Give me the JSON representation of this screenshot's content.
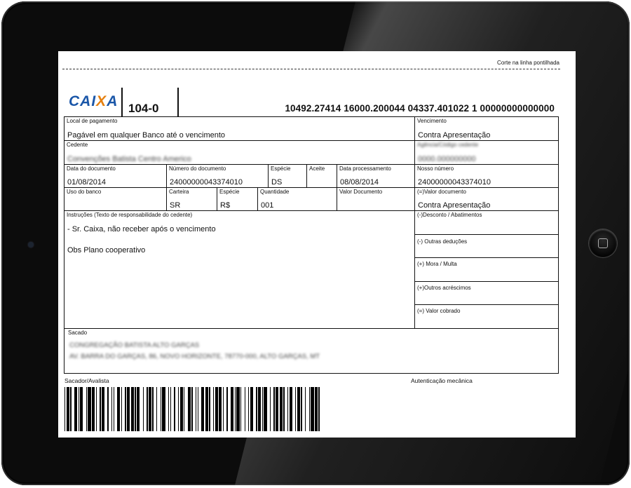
{
  "cut_line": "Corte na linha pontilhada",
  "header": {
    "bank_logo": "CAIXA",
    "bank_code": "104-0",
    "digitable_line": "10492.27414 16000.200044 04337.401022 1 00000000000000"
  },
  "row1": {
    "local_label": "Local de pagamento",
    "local_value": "Pagável em qualquer Banco até o vencimento",
    "venc_label": "Vencimento",
    "venc_value": "Contra Apresentação"
  },
  "row2": {
    "cedente_label": "Cedente",
    "cedente_value": "Convenções Batista Centro Americo",
    "agencia_label": "Agência/Código cedente",
    "agencia_value": "0000.000000000"
  },
  "row3": {
    "data_doc_label": "Data do documento",
    "data_doc_value": "01/08/2014",
    "num_doc_label": "Número do documento",
    "num_doc_value": "24000000043374010",
    "especie_label": "Espécie",
    "especie_value": "DS",
    "aceite_label": "Aceite",
    "data_proc_label": "Data processamento",
    "data_proc_value": "08/08/2014",
    "nosso_label": "Nosso número",
    "nosso_value": "24000000043374010"
  },
  "row4": {
    "uso_label": "Uso do banco",
    "carteira_label": "Carteira",
    "carteira_value": "SR",
    "especie_label": "Espécie",
    "especie_value": "R$",
    "qtd_label": "Quantidade",
    "qtd_value": "001",
    "valor_label": "Valor Documento",
    "valor_doc_label": "(=)Valor documento",
    "valor_doc_value": "Contra Apresentação"
  },
  "instructions": {
    "label": "Instruções (Texto de responsabilidade do cedente)",
    "line1": "- Sr. Caixa, não receber após o vencimento",
    "line2": "Obs Plano cooperativo"
  },
  "right_stack": {
    "desconto": "(-)Desconto / Abatimentos",
    "deducoes": "(-) Outras deduções",
    "mora": "(+) Mora / Multa",
    "acrescimos": "(+)Outros acréscimos",
    "cobrado": "(=) Valor cobrado"
  },
  "sacado": {
    "label": "Sacado",
    "line1": "CONGREGAÇÃO BATISTA ALTO GARÇAS",
    "line2": "AV. BARRA DO GARÇAS, 86, NOVO HORIZONTE, 78770-000, ALTO GARÇAS, MT"
  },
  "footer": {
    "avalista_label": "Sacador/Avalista",
    "autenticacao_label": "Autenticação mecânica"
  }
}
